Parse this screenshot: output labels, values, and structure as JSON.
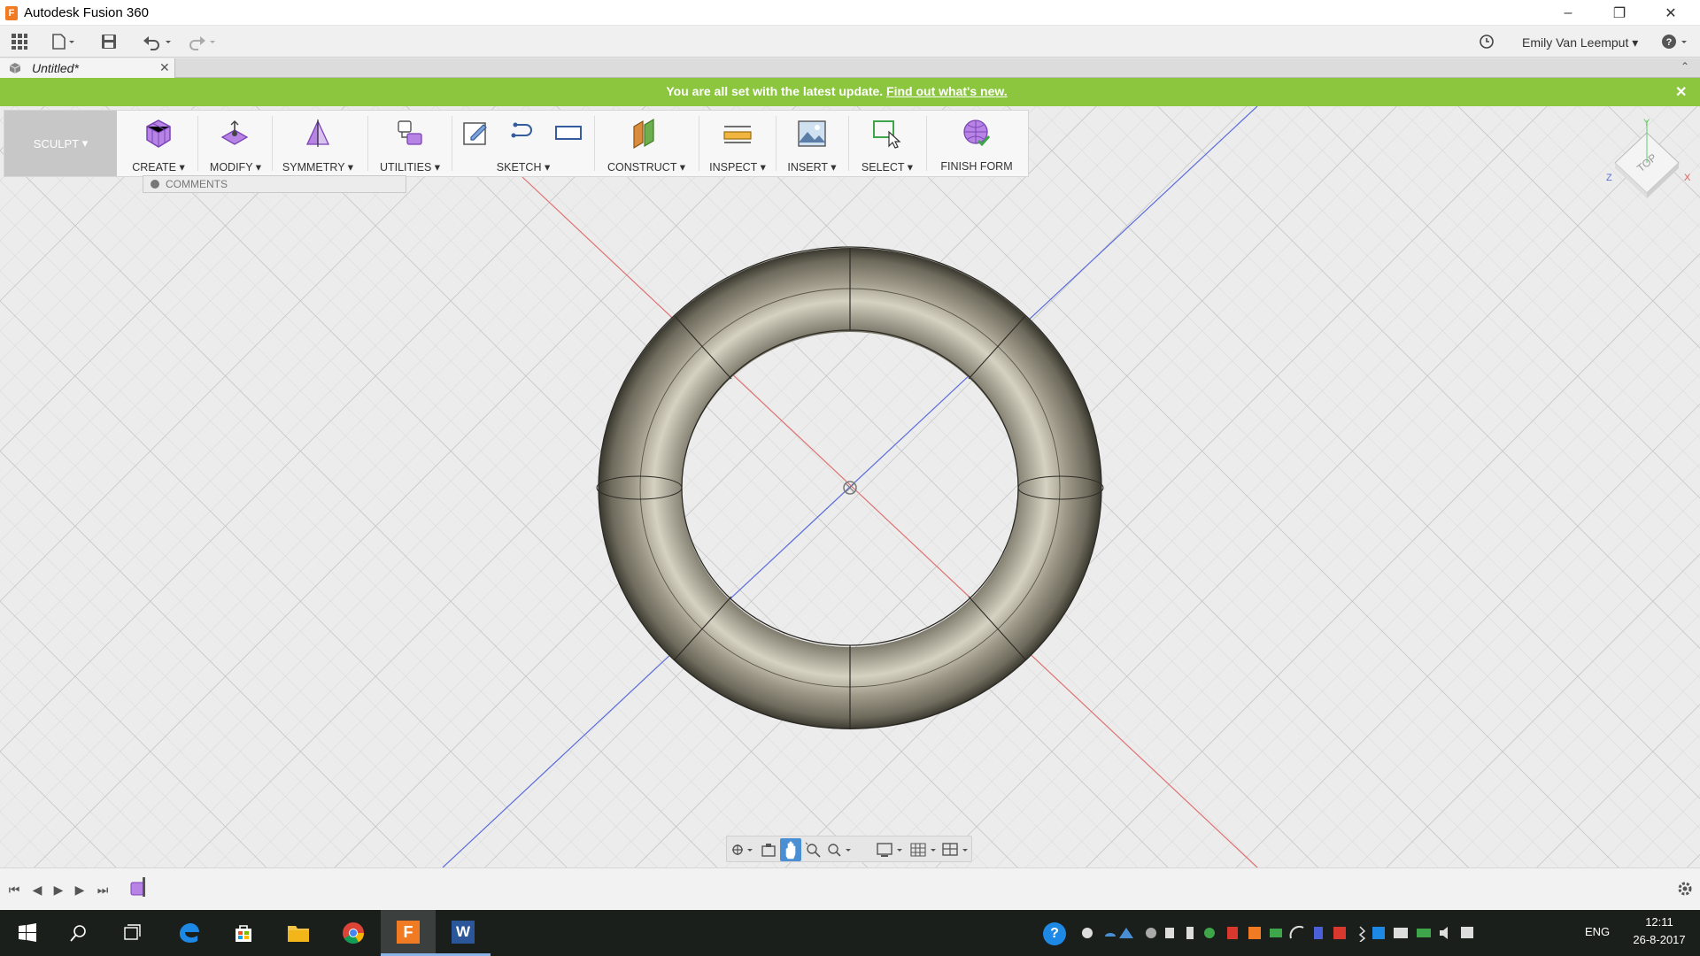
{
  "app": {
    "title": "Autodesk Fusion 360",
    "user": "Emily Van Leemput"
  },
  "document": {
    "tab_title": "Untitled*"
  },
  "banner": {
    "text": "You are all set with the latest update.",
    "link": "Find out what's new."
  },
  "workspace": {
    "label": "SCULPT"
  },
  "ribbon": {
    "create": "CREATE",
    "modify": "MODIFY",
    "symmetry": "SYMMETRY",
    "utilities": "UTILITIES",
    "sketch": "SKETCH",
    "construct": "CONSTRUCT",
    "inspect": "INSPECT",
    "insert": "INSERT",
    "select": "SELECT",
    "finish_form": "FINISH FORM"
  },
  "browser": {
    "comments": "COMMENTS"
  },
  "viewcube": {
    "face": "TOP",
    "axis_x": "X",
    "axis_y": "Y",
    "axis_z": "Z"
  },
  "taskbar": {
    "time": "12:11",
    "date": "26-8-2017",
    "lang": "ENG"
  },
  "colors": {
    "banner": "#8cc63f",
    "accent": "#f07b22",
    "x_axis": "#e06060",
    "z_axis": "#4a5fd8",
    "taskbar": "#1a1f1c"
  }
}
